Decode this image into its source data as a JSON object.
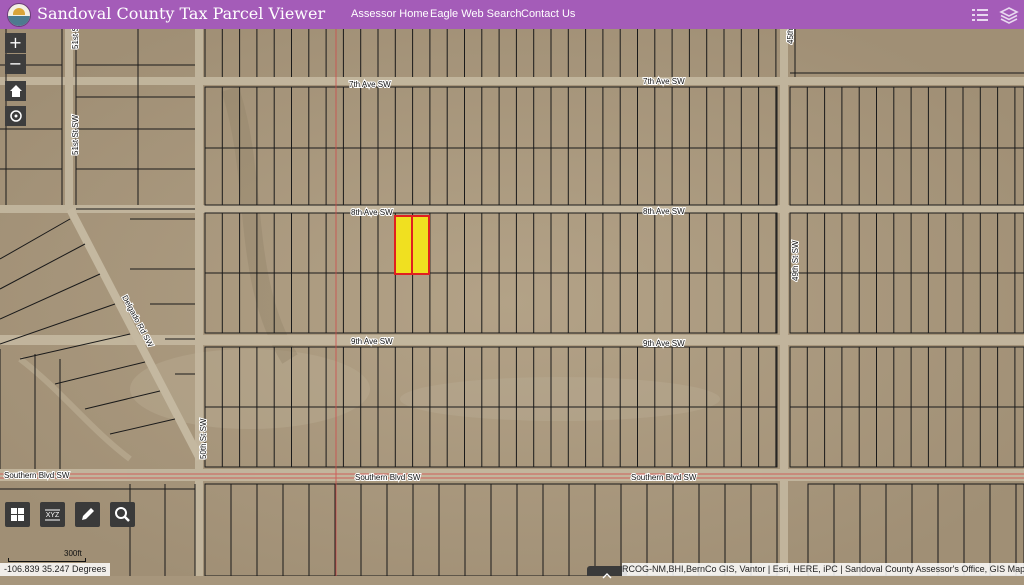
{
  "header": {
    "title": "Sandoval County Tax Parcel Viewer",
    "logo_icon": "county-seal",
    "links": [
      "Assessor Home",
      "Eagle Web Search",
      "Contact Us"
    ],
    "right_icons": [
      "layer-list-icon",
      "layers-icon"
    ],
    "bg_color": "#a45cb8"
  },
  "map": {
    "basemap": "satellite imagery",
    "roads": {
      "seventh_ave": "7th Ave SW",
      "eighth_ave": "8th Ave SW",
      "ninth_ave": "9th Ave SW",
      "southern_blvd": "Southern Blvd SW",
      "fifty_first": "51st St SW",
      "fiftieth": "50th St SW",
      "forty_ninth": "49th St SW",
      "forty_fifth": "45th St SW",
      "delgado": "Delgado Rd SW"
    },
    "selected_parcel_count": 2,
    "selection_fill": "#f0e020",
    "selection_outline": "#e02020",
    "parcel_line_color": "#1a1a1a"
  },
  "controls": {
    "zoom_in": "+",
    "zoom_out": "−",
    "home_icon": "home-icon",
    "locate_icon": "locate-icon",
    "tools": [
      "grid-icon",
      "xyz-icon",
      "pencil-icon",
      "search-icon"
    ]
  },
  "status": {
    "coordinates": "-106.839 35.247 Degrees",
    "scale": "300ft",
    "attribution": "RCOG-NM,BHI,BernCo GIS, Vantor | Esri, HERE, iPC | Sandoval County Assessor's Office, GIS Map"
  }
}
